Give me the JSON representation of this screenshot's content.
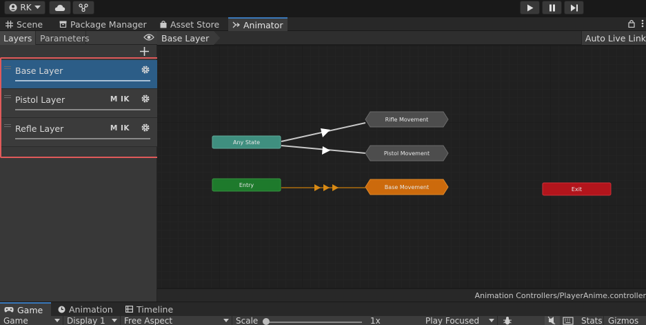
{
  "toolbar": {
    "account_label": "RK"
  },
  "window_tabs": {
    "scene": "Scene",
    "package_manager": "Package Manager",
    "asset_store": "Asset Store",
    "animator": "Animator"
  },
  "left_panel": {
    "tabs": {
      "layers": "Layers",
      "parameters": "Parameters"
    },
    "layers": [
      {
        "name": "Base Layer",
        "badges": "",
        "selected": true
      },
      {
        "name": "Pistol Layer",
        "badges": "M IK",
        "selected": false
      },
      {
        "name": "Refle Layer",
        "badges": "M IK",
        "selected": false
      }
    ]
  },
  "graph": {
    "breadcrumb": "Base Layer",
    "auto_live_link": "Auto Live Link",
    "states": {
      "any_state": "Any State",
      "entry": "Entry",
      "exit": "Exit",
      "rifle_movement": "Rifle Movement",
      "pistol_movement": "Pistol Movement",
      "base_movement": "Base Movement"
    },
    "colors": {
      "any_state": "#3f8f7f",
      "entry": "#1e7a2c",
      "exit": "#b3151c",
      "default_state": "#cc6a0c",
      "state": "#4d4d4d",
      "canvas": "#202020",
      "selection_highlight": "#e15a5a"
    },
    "controller_path": "Animation Controllers/PlayerAnime.controller"
  },
  "bottom_tabs": {
    "game": "Game",
    "animation": "Animation",
    "timeline": "Timeline"
  },
  "game_toolbar": {
    "display_mode": "Game",
    "display": "Display 1",
    "aspect": "Free Aspect",
    "scale_label": "Scale",
    "scale_value": "1x",
    "play_mode": "Play Focused",
    "stats": "Stats",
    "gizmos": "Gizmos"
  }
}
